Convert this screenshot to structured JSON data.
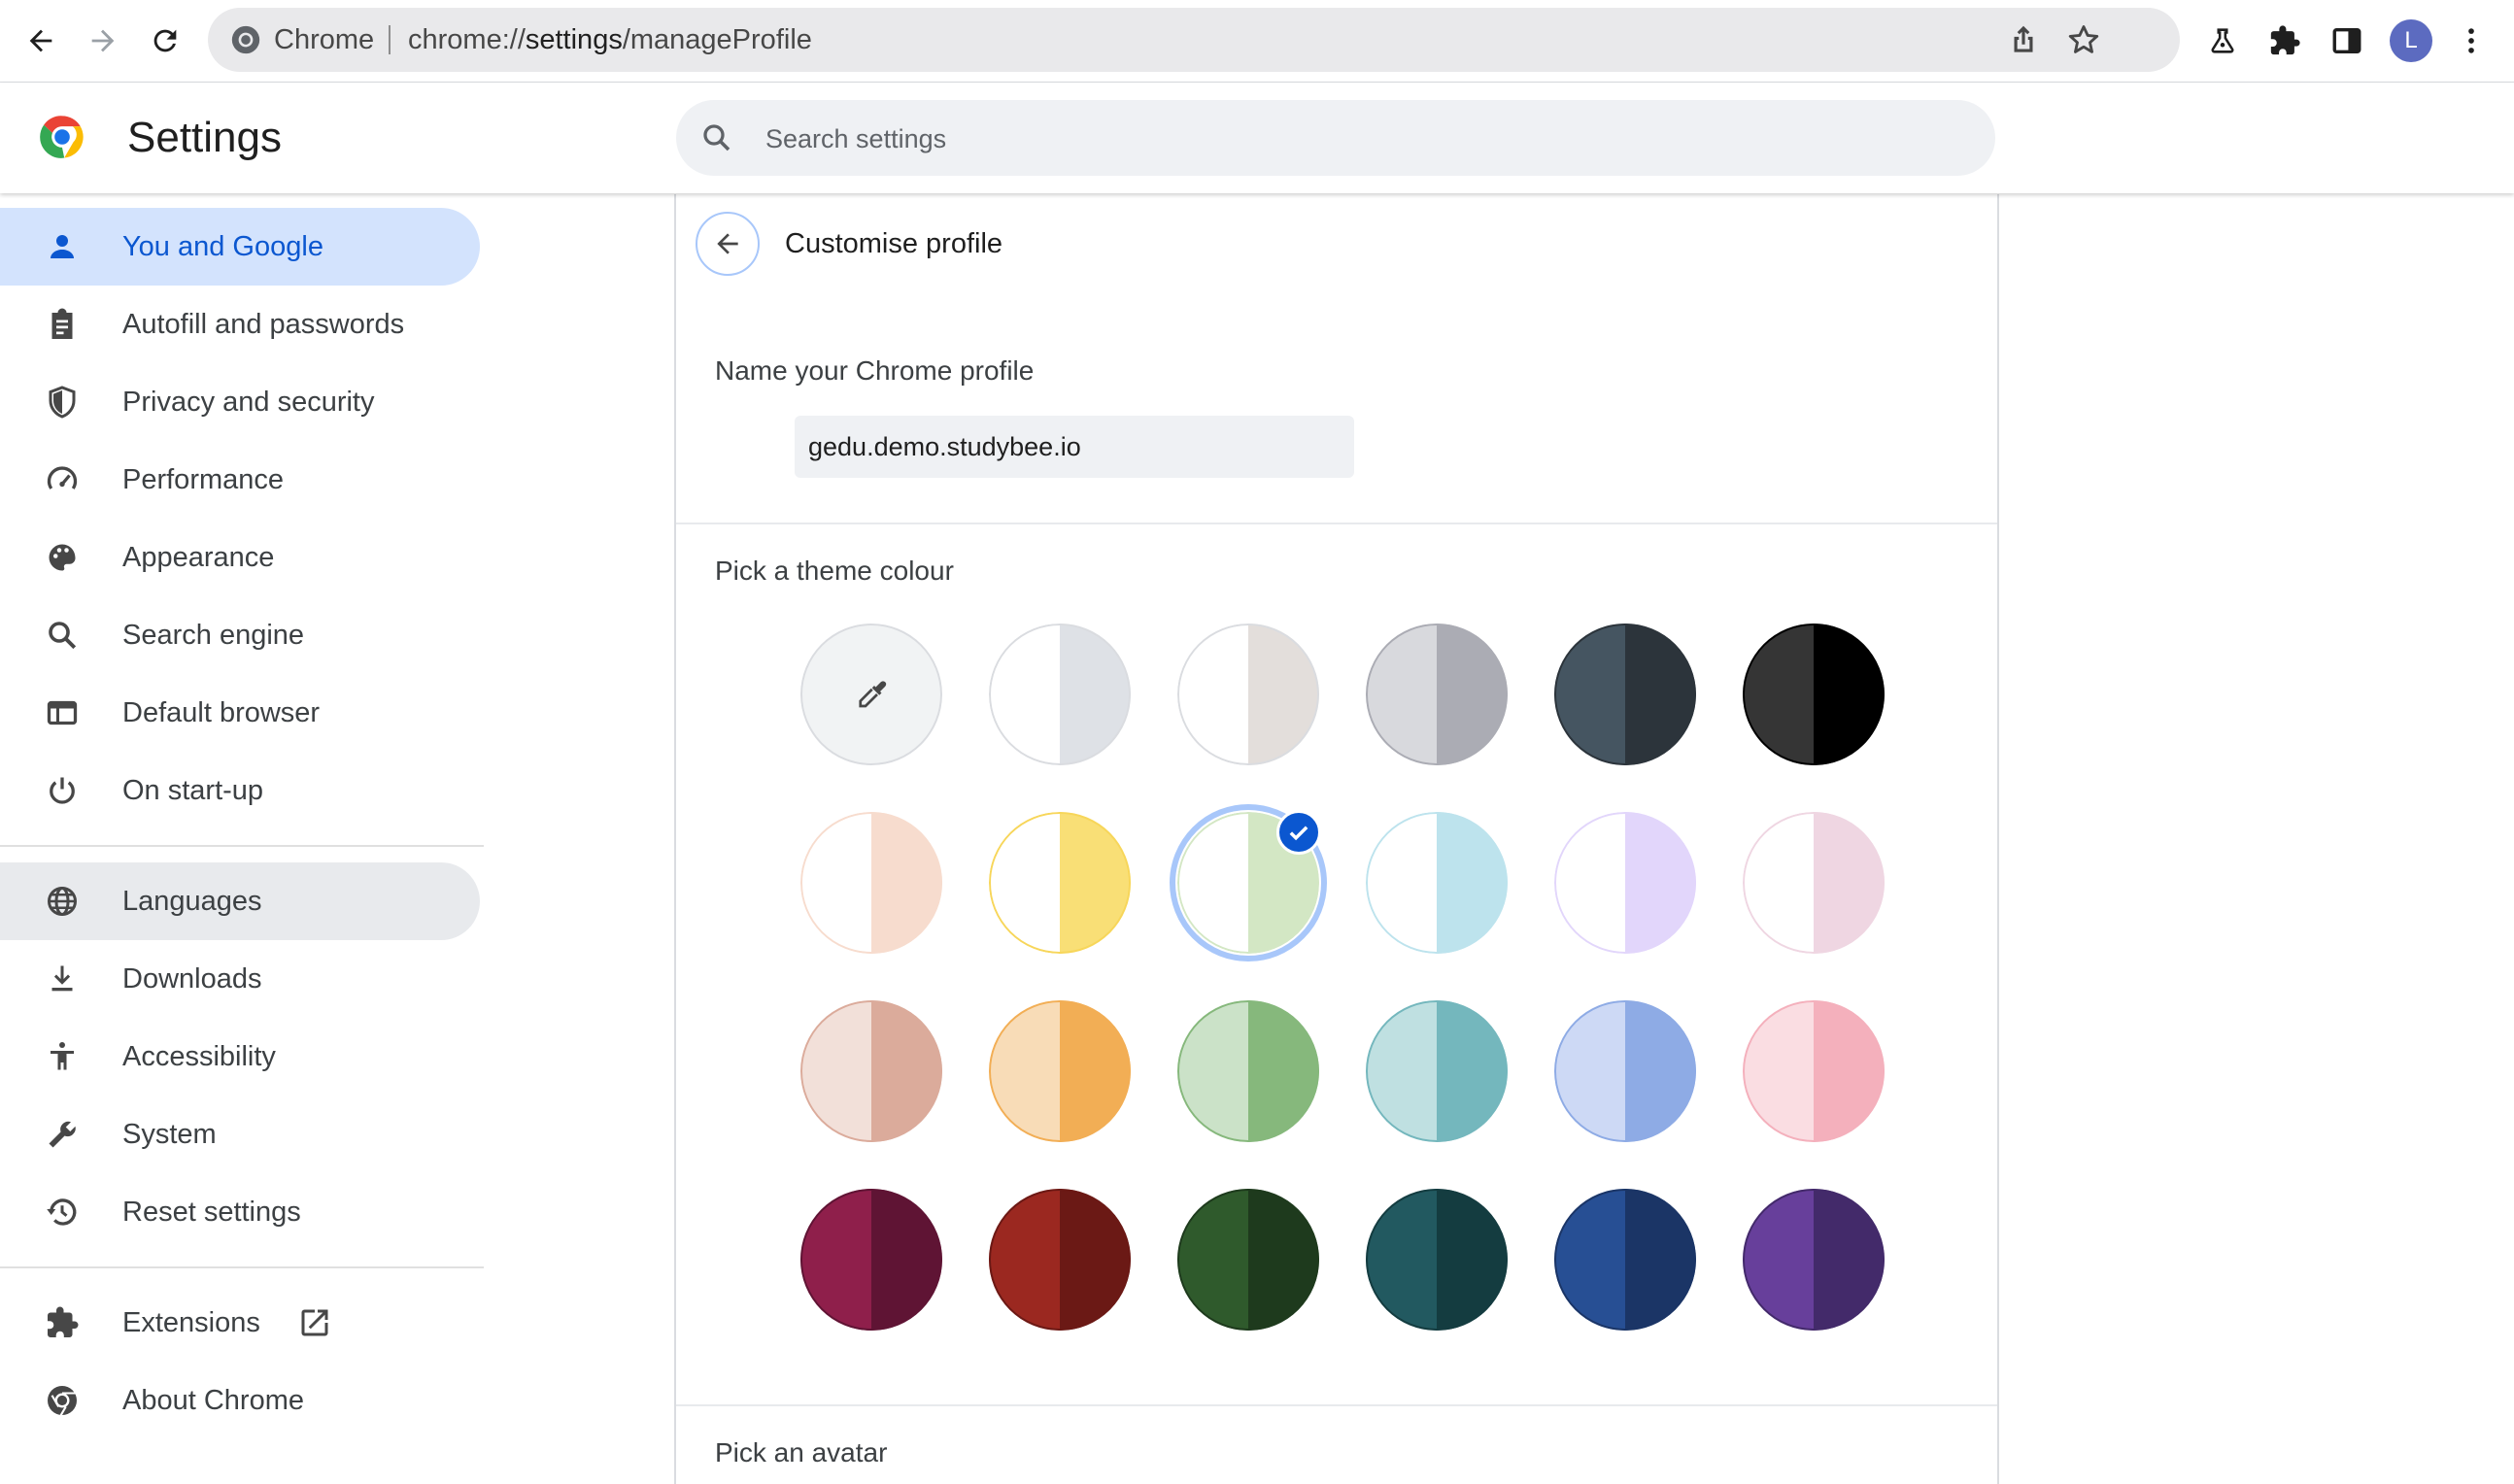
{
  "browser": {
    "omnibox_label": "Chrome",
    "url_prefix": "chrome://",
    "url_host": "settings",
    "url_path": "/manageProfile",
    "profile_initial": "L"
  },
  "header": {
    "title": "Settings",
    "search_placeholder": "Search settings"
  },
  "sidebar": {
    "items": [
      {
        "label": "You and Google",
        "icon": "person-icon"
      },
      {
        "label": "Autofill and passwords",
        "icon": "clipboard-icon"
      },
      {
        "label": "Privacy and security",
        "icon": "shield-icon"
      },
      {
        "label": "Performance",
        "icon": "speedometer-icon"
      },
      {
        "label": "Appearance",
        "icon": "palette-icon"
      },
      {
        "label": "Search engine",
        "icon": "search-icon"
      },
      {
        "label": "Default browser",
        "icon": "browser-window-icon"
      },
      {
        "label": "On start-up",
        "icon": "power-icon"
      },
      {
        "label": "Languages",
        "icon": "globe-icon"
      },
      {
        "label": "Downloads",
        "icon": "download-icon"
      },
      {
        "label": "Accessibility",
        "icon": "accessibility-icon"
      },
      {
        "label": "System",
        "icon": "wrench-icon"
      },
      {
        "label": "Reset settings",
        "icon": "history-icon"
      },
      {
        "label": "Extensions",
        "icon": "puzzle-icon"
      },
      {
        "label": "About Chrome",
        "icon": "chrome-icon"
      }
    ]
  },
  "main": {
    "subpage_title": "Customise profile",
    "name_label": "Name your Chrome profile",
    "name_value": "gedu.demo.studybee.io",
    "theme_label": "Pick a theme colour",
    "avatar_label": "Pick an avatar",
    "theme_colours": [
      [
        {
          "l": "#f1f3f4",
          "r": "#f1f3f4",
          "ring": "#dadce0",
          "custom": true
        },
        {
          "l": "#ffffff",
          "r": "#dee1e6",
          "ring": "#dadce0"
        },
        {
          "l": "#ffffff",
          "r": "#e3dedb",
          "ring": "#dadce0"
        },
        {
          "l": "#d8d9dd",
          "r": "#abacb4",
          "ring": "#abacb4"
        },
        {
          "l": "#455561",
          "r": "#2c343b",
          "ring": "#2c343b"
        },
        {
          "l": "#353535",
          "r": "#000000",
          "ring": "#000000"
        }
      ],
      [
        {
          "l": "#ffffff",
          "r": "#f7dcce",
          "ring": "#f7dcce"
        },
        {
          "l": "#ffffff",
          "r": "#f9df76",
          "ring": "#f7d65a"
        },
        {
          "l": "#ffffff",
          "r": "#d3e7c4",
          "ring": "#d3e7c4",
          "selected": true
        },
        {
          "l": "#ffffff",
          "r": "#bde3ed",
          "ring": "#bde3ed"
        },
        {
          "l": "#ffffff",
          "r": "#e2d6fb",
          "ring": "#e2d6fb"
        },
        {
          "l": "#ffffff",
          "r": "#efd6e2",
          "ring": "#efd6e2"
        }
      ],
      [
        {
          "l": "#f2e0d9",
          "r": "#dbab9b",
          "ring": "#dbab9b"
        },
        {
          "l": "#f8dcb7",
          "r": "#f2ae55",
          "ring": "#f2ae55"
        },
        {
          "l": "#cbe2c8",
          "r": "#86b87c",
          "ring": "#86b87c"
        },
        {
          "l": "#bfe0e1",
          "r": "#74b7bd",
          "ring": "#74b7bd"
        },
        {
          "l": "#cdd9f5",
          "r": "#8eabe5",
          "ring": "#8eabe5"
        },
        {
          "l": "#fadde2",
          "r": "#f4b0bc",
          "ring": "#f4b0bc"
        }
      ],
      [
        {
          "l": "#8f1f4b",
          "r": "#5f1434",
          "ring": "#5f1434"
        },
        {
          "l": "#9b2820",
          "r": "#6b1915",
          "ring": "#6b1915"
        },
        {
          "l": "#2f5a2c",
          "r": "#1e3a1d",
          "ring": "#1e3a1d"
        },
        {
          "l": "#225960",
          "r": "#143c40",
          "ring": "#143c40"
        },
        {
          "l": "#274f94",
          "r": "#1b3566",
          "ring": "#1b3566"
        },
        {
          "l": "#673f9b",
          "r": "#432a6a",
          "ring": "#432a6a"
        }
      ]
    ]
  }
}
